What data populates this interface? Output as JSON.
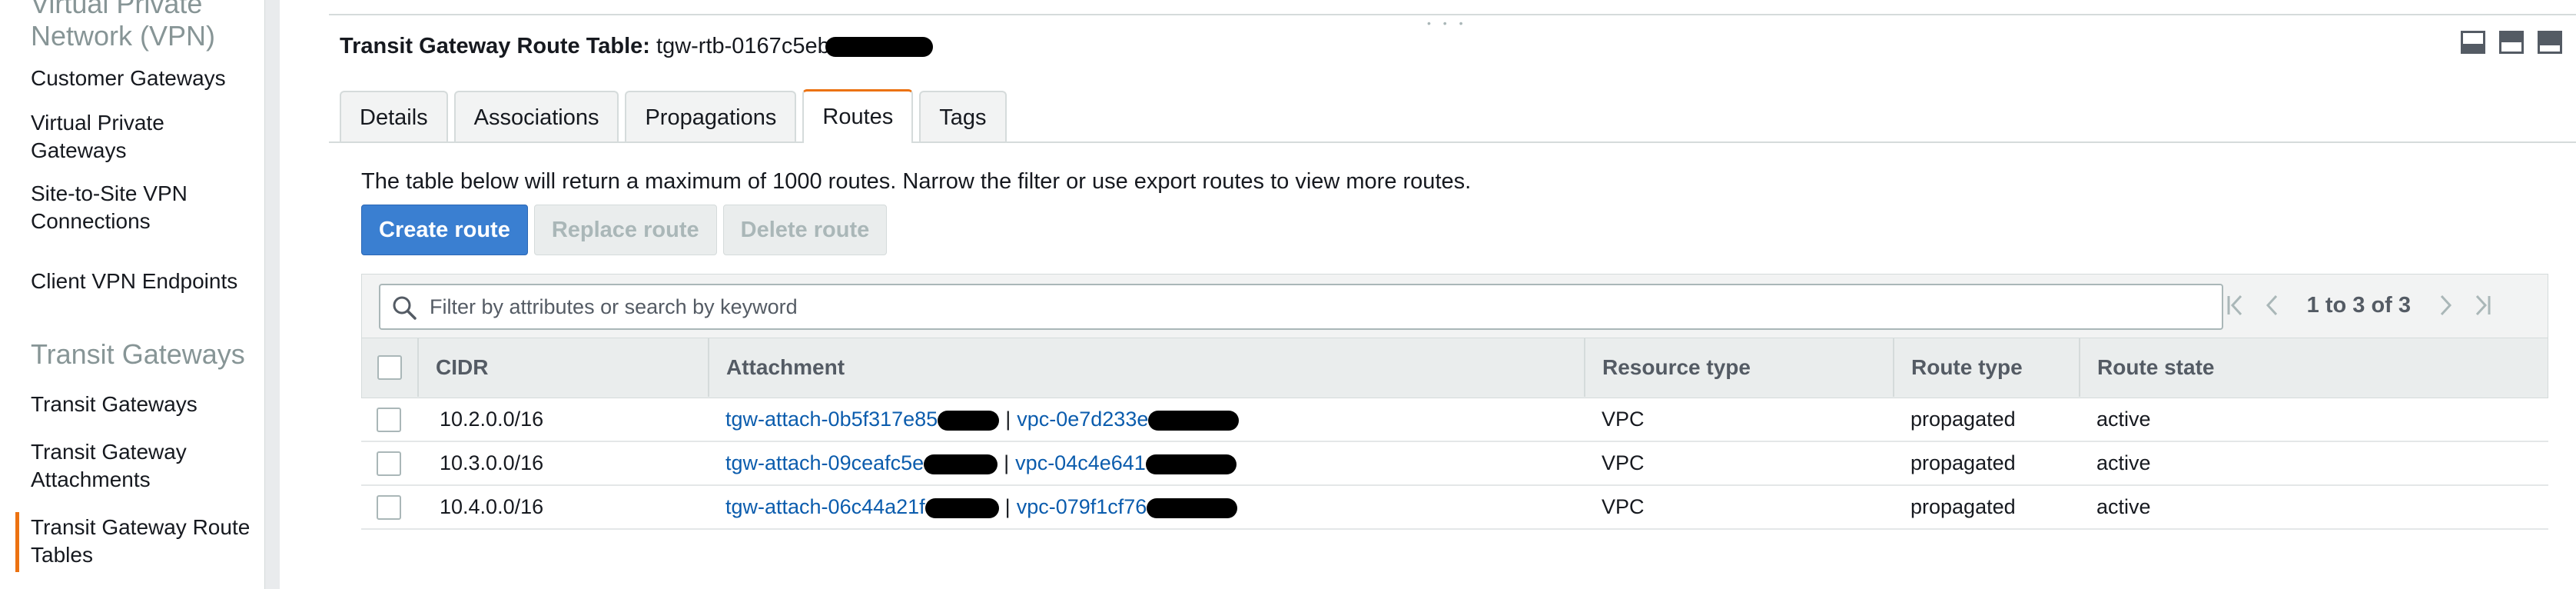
{
  "sidebar": {
    "section_vpn": "Virtual Private\nNetwork (VPN)",
    "vpn_items": [
      {
        "label": "Customer Gateways"
      },
      {
        "label": "Virtual Private Gateways"
      },
      {
        "label": "Site-to-Site VPN Connections"
      },
      {
        "label": "Client VPN Endpoints"
      }
    ],
    "section_transit": "Transit Gateways",
    "transit_items": [
      {
        "label": "Transit Gateways"
      },
      {
        "label": "Transit Gateway Attachments"
      },
      {
        "label": "Transit Gateway Route Tables",
        "active": true
      }
    ]
  },
  "panel": {
    "title_label": "Transit Gateway Route Table:",
    "title_value": "tgw-rtb-0167c5eb",
    "tabs": [
      {
        "label": "Details"
      },
      {
        "label": "Associations"
      },
      {
        "label": "Propagations"
      },
      {
        "label": "Routes",
        "active": true
      },
      {
        "label": "Tags"
      }
    ],
    "notice": "The table below will return a maximum of 1000 routes. Narrow the filter or use export routes to view more routes.",
    "buttons": {
      "create": "Create route",
      "replace": "Replace route",
      "delete": "Delete route"
    }
  },
  "table": {
    "search_placeholder": "Filter by attributes or search by keyword",
    "pagination": "1 to 3 of 3",
    "columns": [
      "CIDR",
      "Attachment",
      "Resource type",
      "Route type",
      "Route state"
    ],
    "rows": [
      {
        "cidr": "10.2.0.0/16",
        "attachment": "tgw-attach-0b5f317e85",
        "vpc": "vpc-0e7d233e",
        "resource_type": "VPC",
        "route_type": "propagated",
        "route_state": "active"
      },
      {
        "cidr": "10.3.0.0/16",
        "attachment": "tgw-attach-09ceafc5e",
        "vpc": "vpc-04c4e641",
        "resource_type": "VPC",
        "route_type": "propagated",
        "route_state": "active"
      },
      {
        "cidr": "10.4.0.0/16",
        "attachment": "tgw-attach-06c44a21f",
        "vpc": "vpc-079f1cf76",
        "resource_type": "VPC",
        "route_type": "propagated",
        "route_state": "active"
      }
    ]
  },
  "colors": {
    "accent": "#ec7211",
    "primary_button": "#3a7fd1",
    "link": "#0b5cad"
  }
}
